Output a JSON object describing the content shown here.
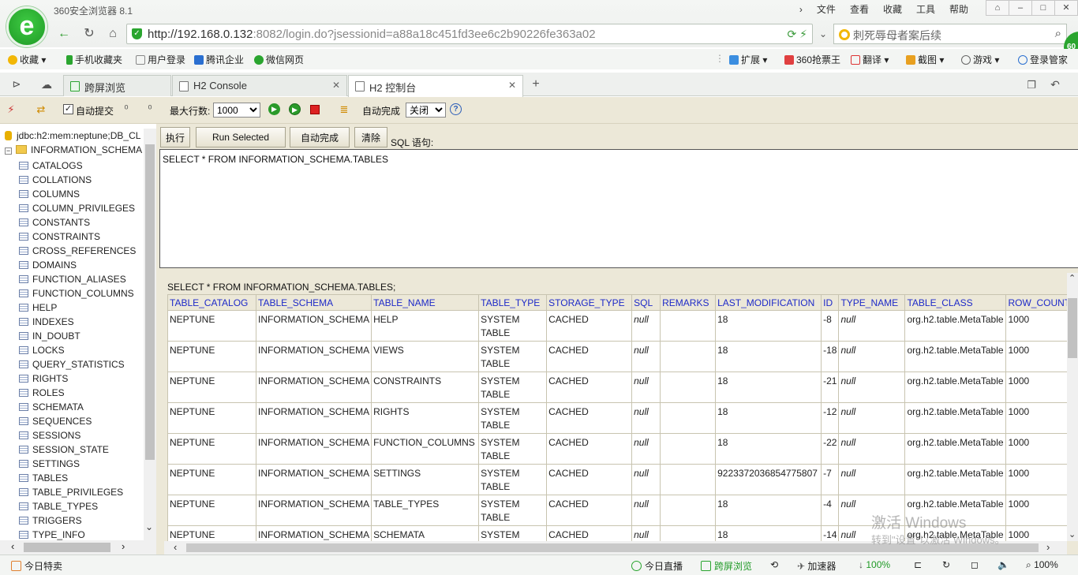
{
  "browser": {
    "title": "360安全浏览器 8.1",
    "menu": [
      "文件",
      "查看",
      "收藏",
      "工具",
      "帮助"
    ],
    "url_host": "http://192.168.0.132",
    "url_rest": ":8082/login.do?jsessionid=a88a18c451fd3ee6c2b90226fe363a02",
    "search_text": "刺死辱母者案后续",
    "badge": "60"
  },
  "bookmarks": {
    "left": [
      "收藏",
      "手机收藏夹",
      "用户登录",
      "腾讯企业",
      "微信网页"
    ],
    "right": [
      "扩展",
      "360抢票王",
      "翻译",
      "截图",
      "游戏",
      "登录管家"
    ]
  },
  "tabs": [
    {
      "label": "跨屏浏览"
    },
    {
      "label": "H2 Console"
    },
    {
      "label": "H2 控制台"
    }
  ],
  "toolbar": {
    "auto_commit": "自动提交",
    "max_rows_label": "最大行数:",
    "max_rows_value": "1000",
    "auto_complete_label": "自动完成",
    "auto_complete_value": "关闭",
    "help": "?"
  },
  "tree": {
    "connection": "jdbc:h2:mem:neptune;DB_CL",
    "schema": "INFORMATION_SCHEMA",
    "items": [
      "CATALOGS",
      "COLLATIONS",
      "COLUMNS",
      "COLUMN_PRIVILEGES",
      "CONSTANTS",
      "CONSTRAINTS",
      "CROSS_REFERENCES",
      "DOMAINS",
      "FUNCTION_ALIASES",
      "FUNCTION_COLUMNS",
      "HELP",
      "INDEXES",
      "IN_DOUBT",
      "LOCKS",
      "QUERY_STATISTICS",
      "RIGHTS",
      "ROLES",
      "SCHEMATA",
      "SEQUENCES",
      "SESSIONS",
      "SESSION_STATE",
      "SETTINGS",
      "TABLES",
      "TABLE_PRIVILEGES",
      "TABLE_TYPES",
      "TRIGGERS",
      "TYPE_INFO"
    ]
  },
  "query": {
    "buttons": [
      "执行",
      "Run Selected",
      "自动完成",
      "清除"
    ],
    "sql_label": "SQL 语句:",
    "sql_text": "SELECT * FROM INFORMATION_SCHEMA.TABLES"
  },
  "result": {
    "statement": "SELECT * FROM INFORMATION_SCHEMA.TABLES;",
    "columns": [
      "TABLE_CATALOG",
      "TABLE_SCHEMA",
      "TABLE_NAME",
      "TABLE_TYPE",
      "STORAGE_TYPE",
      "SQL",
      "REMARKS",
      "LAST_MODIFICATION",
      "ID",
      "TYPE_NAME",
      "TABLE_CLASS",
      "ROW_COUNT_ESTIMATE"
    ],
    "rows": [
      [
        "NEPTUNE",
        "INFORMATION_SCHEMA",
        "HELP",
        "SYSTEM\nTABLE",
        "CACHED",
        "null",
        "",
        "18",
        "-8",
        "null",
        "org.h2.table.MetaTable",
        "1000"
      ],
      [
        "NEPTUNE",
        "INFORMATION_SCHEMA",
        "VIEWS",
        "SYSTEM\nTABLE",
        "CACHED",
        "null",
        "",
        "18",
        "-18",
        "null",
        "org.h2.table.MetaTable",
        "1000"
      ],
      [
        "NEPTUNE",
        "INFORMATION_SCHEMA",
        "CONSTRAINTS",
        "SYSTEM\nTABLE",
        "CACHED",
        "null",
        "",
        "18",
        "-21",
        "null",
        "org.h2.table.MetaTable",
        "1000"
      ],
      [
        "NEPTUNE",
        "INFORMATION_SCHEMA",
        "RIGHTS",
        "SYSTEM\nTABLE",
        "CACHED",
        "null",
        "",
        "18",
        "-12",
        "null",
        "org.h2.table.MetaTable",
        "1000"
      ],
      [
        "NEPTUNE",
        "INFORMATION_SCHEMA",
        "FUNCTION_COLUMNS",
        "SYSTEM\nTABLE",
        "CACHED",
        "null",
        "",
        "18",
        "-22",
        "null",
        "org.h2.table.MetaTable",
        "1000"
      ],
      [
        "NEPTUNE",
        "INFORMATION_SCHEMA",
        "SETTINGS",
        "SYSTEM\nTABLE",
        "CACHED",
        "null",
        "",
        "9223372036854775807",
        "-7",
        "null",
        "org.h2.table.MetaTable",
        "1000"
      ],
      [
        "NEPTUNE",
        "INFORMATION_SCHEMA",
        "TABLE_TYPES",
        "SYSTEM\nTABLE",
        "CACHED",
        "null",
        "",
        "18",
        "-4",
        "null",
        "org.h2.table.MetaTable",
        "1000"
      ],
      [
        "NEPTUNE",
        "INFORMATION_SCHEMA",
        "SCHEMATA",
        "SYSTEM\nTABLE",
        "CACHED",
        "null",
        "",
        "18",
        "-14",
        "null",
        "org.h2.table.MetaTable",
        "1000"
      ]
    ]
  },
  "watermark": {
    "line1": "激活 Windows",
    "line2": "转到\"设置\"以激活 Windows。"
  },
  "status": {
    "today_deals": "今日特卖",
    "live": "今日直播",
    "cross_screen": "跨屏浏览",
    "accelerator": "加速器",
    "download_pct": "100%",
    "zoom": "100%"
  }
}
